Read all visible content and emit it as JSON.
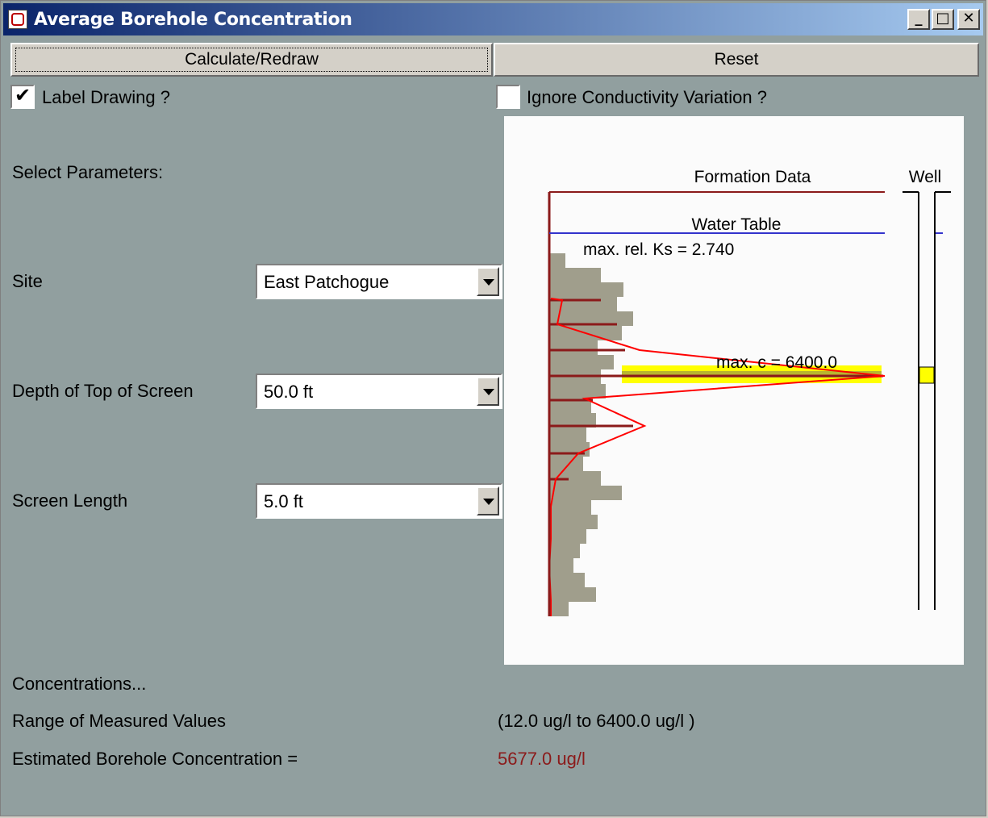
{
  "window": {
    "title": "Average Borehole Concentration",
    "controls": {
      "minimize": "_",
      "maximize": "□",
      "close": "✕"
    }
  },
  "toolbar": {
    "calculate_label": "Calculate/Redraw",
    "reset_label": "Reset"
  },
  "options": {
    "label_drawing": {
      "label": "Label Drawing ?",
      "checked": true
    },
    "ignore_conductivity": {
      "label": "Ignore Conductivity Variation ?",
      "checked": false
    }
  },
  "params": {
    "heading": "Select Parameters:",
    "site": {
      "label": "Site",
      "value": "East Patchogue"
    },
    "depth_top": {
      "label": "Depth of Top of Screen",
      "value": "50.0 ft"
    },
    "screen_length": {
      "label": "Screen Length",
      "value": "5.0 ft"
    }
  },
  "drawing": {
    "formation_label": "Formation Data",
    "well_label": "Well",
    "water_table_label": "Water Table",
    "max_ks_label": "max. rel. Ks = 2.740",
    "max_c_label": "max. c = 6400.0",
    "colors": {
      "ks_bars": "#a09e8c",
      "concentration": "#ff0000",
      "formation": "#8b1a1a",
      "water_table": "#3333cc",
      "screen": "#ffff00"
    }
  },
  "results": {
    "heading": "Concentrations...",
    "range_label": "Range of Measured Values",
    "range_value": "(12.0 ug/l to 6400.0 ug/l )",
    "estimate_label": "Estimated Borehole Concentration =",
    "estimate_value": "5677.0 ug/l"
  }
}
